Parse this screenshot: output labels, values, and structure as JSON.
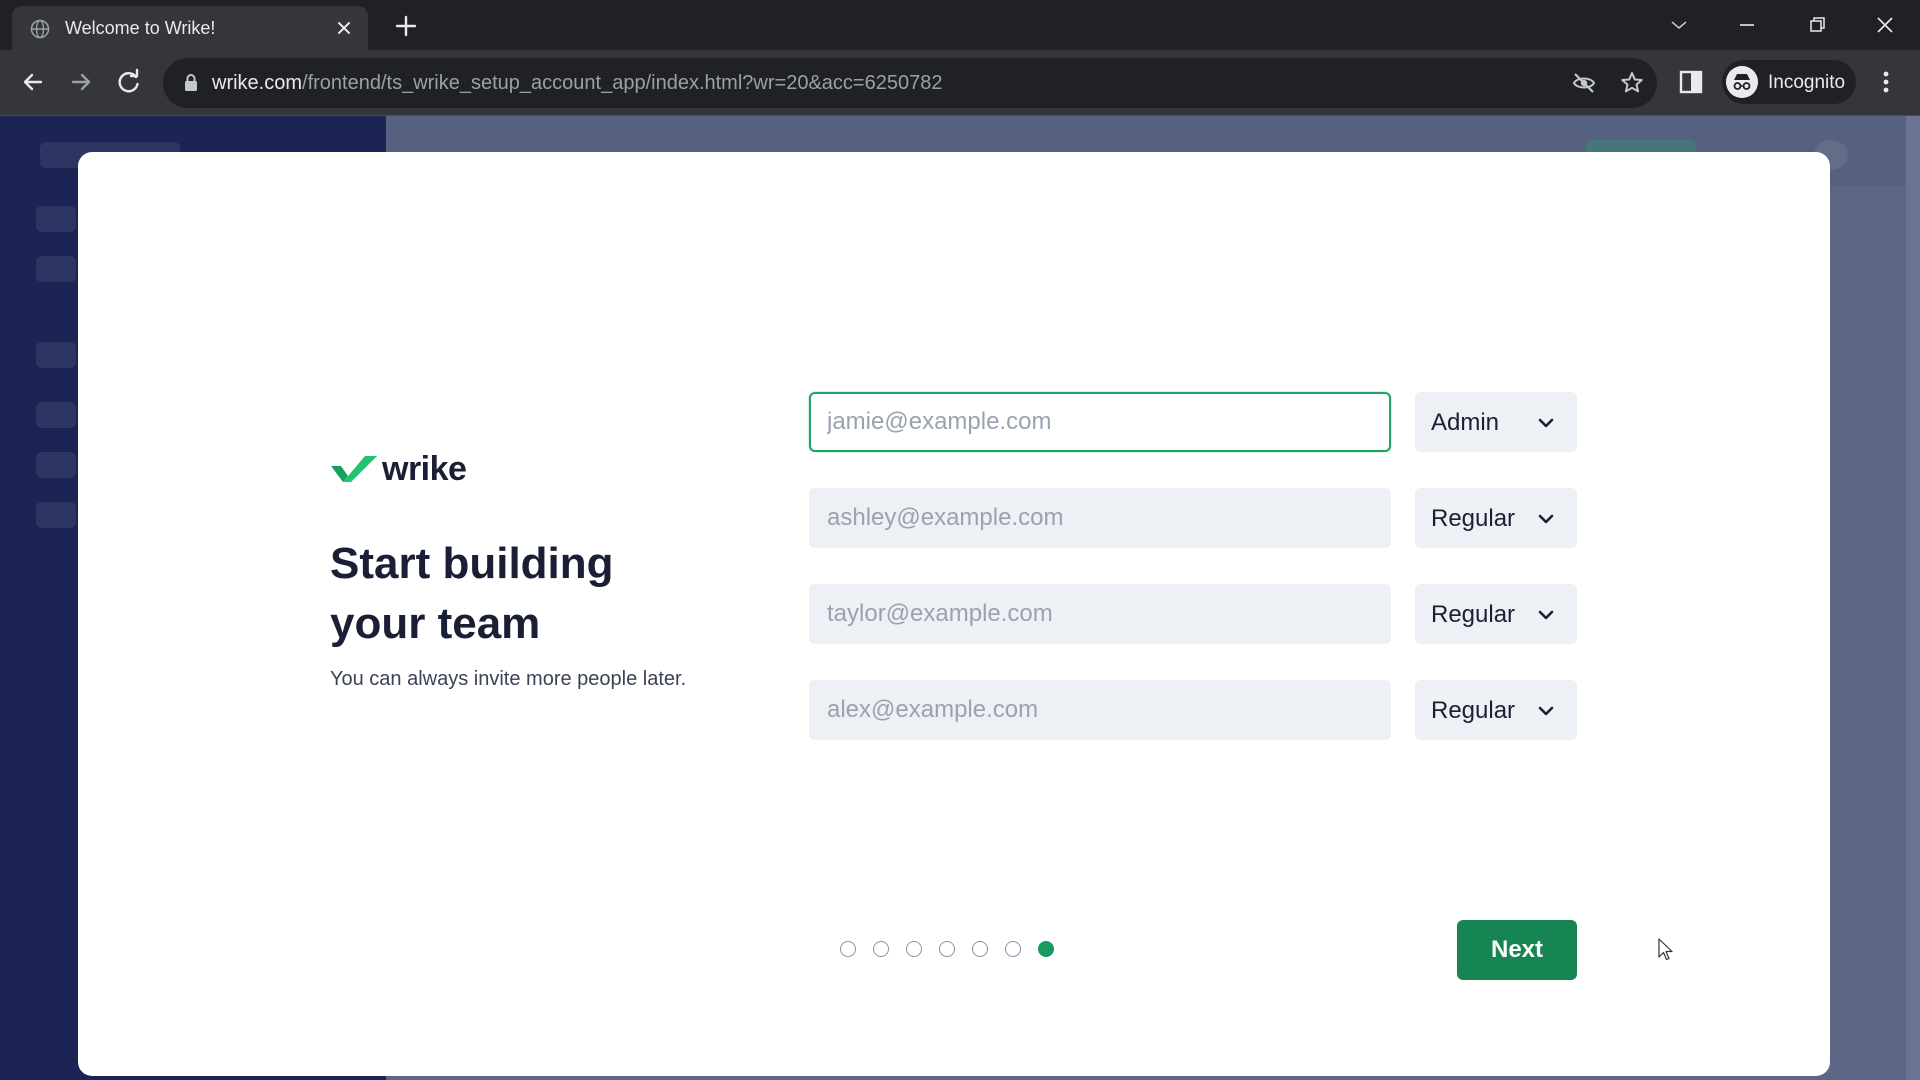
{
  "browser": {
    "tab_title": "Welcome to Wrike!",
    "url_host": "wrike.com",
    "url_path": "/frontend/ts_wrike_setup_account_app/index.html?wr=20&acc=6250782",
    "profile_label": "Incognito"
  },
  "modal": {
    "logo_text": "wrike",
    "heading": "Start building your team",
    "subtext": "You can always invite more people later.",
    "rows": [
      {
        "placeholder": "jamie@example.com",
        "value": "",
        "role": "Admin"
      },
      {
        "placeholder": "ashley@example.com",
        "value": "",
        "role": "Regular"
      },
      {
        "placeholder": "taylor@example.com",
        "value": "",
        "role": "Regular"
      },
      {
        "placeholder": "alex@example.com",
        "value": "",
        "role": "Regular"
      }
    ],
    "progress": {
      "total_steps": 7,
      "current_step": 7
    },
    "next_label": "Next"
  },
  "colors": {
    "accent": "#168453",
    "accent_dot": "#179b5f",
    "focus_border": "#21a366",
    "heading": "#1a1f36",
    "input_bg": "#edf0f4"
  },
  "icons": {
    "tab_favicon": "globe-icon",
    "tab_close": "close-icon",
    "new_tab": "plus-icon",
    "back": "arrow-left-icon",
    "forward": "arrow-right-icon",
    "reload": "reload-icon",
    "lock": "lock-icon",
    "eye_off": "eye-slash-icon",
    "bookmark": "star-icon",
    "side_panel": "side-panel-icon",
    "incognito": "incognito-icon",
    "menu": "kebab-menu-icon",
    "role_dropdown": "chevron-down-icon"
  }
}
